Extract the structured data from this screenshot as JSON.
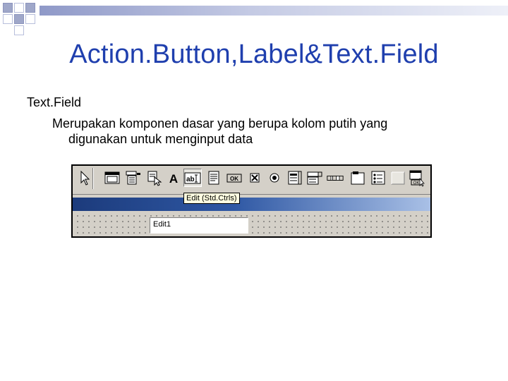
{
  "slide": {
    "title": "Action.Button,Label&Text.Field",
    "bullet_main": "Text.Field",
    "bullet_sub_line1": "Merupakan komponen dasar yang berupa kolom putih yang",
    "bullet_sub_line2": "digunakan untuk menginput data"
  },
  "ide": {
    "palette_items": [
      {
        "icon": "pointer-icon"
      },
      {
        "icon": "form-icon"
      },
      {
        "icon": "main-menu-icon"
      },
      {
        "icon": "popup-menu-icon"
      },
      {
        "icon": "label-icon"
      },
      {
        "icon": "edit-icon",
        "selected": true
      },
      {
        "icon": "memo-icon"
      },
      {
        "icon": "button-icon"
      },
      {
        "icon": "checkbox-icon"
      },
      {
        "icon": "radiobutton-icon"
      },
      {
        "icon": "listbox-icon"
      },
      {
        "icon": "combobox-icon"
      },
      {
        "icon": "scrollbar-icon"
      },
      {
        "icon": "groupbox-icon"
      },
      {
        "icon": "radiogroup-icon"
      },
      {
        "icon": "panel-icon"
      },
      {
        "icon": "actionlist-icon"
      }
    ],
    "tooltip": "Edit (Std.Ctrls)",
    "edit_value": "Edit1"
  },
  "colors": {
    "title": "#1f3fae",
    "form_caption_start": "#1c3b7c",
    "form_caption_end": "#a9c0e6",
    "ide_face": "#d4d0c8"
  }
}
